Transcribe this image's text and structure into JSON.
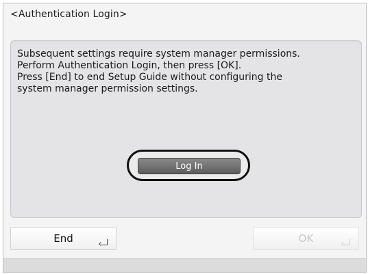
{
  "window": {
    "title": "<Authentication Login>"
  },
  "message": {
    "text": "Subsequent settings require system manager permissions.\nPerform Authentication Login, then press [OK].\nPress [End] to end Setup Guide without configuring the\nsystem manager permission settings."
  },
  "actions": {
    "login_label": "Log In",
    "end_label": "End",
    "ok_label": "OK",
    "ok_enabled": false
  },
  "icons": {
    "enter": "enter-icon"
  },
  "colors": {
    "panel": "#e4e3e6",
    "button_active": "#6b6b6b",
    "disabled_text": "#c7c7c7"
  }
}
